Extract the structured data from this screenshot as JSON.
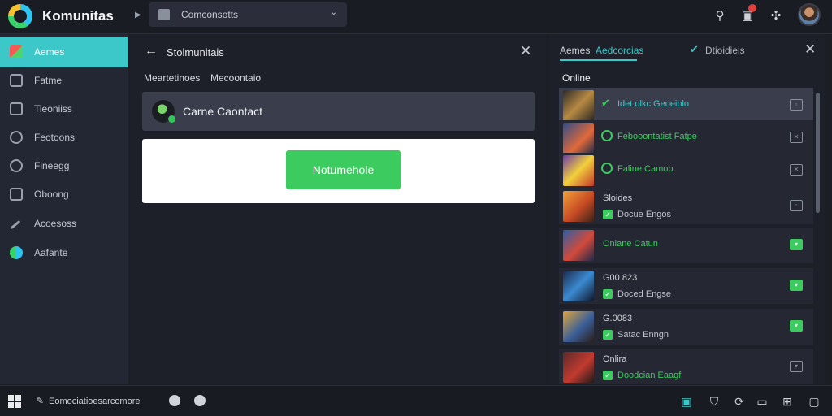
{
  "header": {
    "app_title": "Komunitas",
    "combo_label": "Comconsotts",
    "notification_count": "1"
  },
  "sidebar": {
    "items": [
      {
        "label": "Aemes",
        "active": true
      },
      {
        "label": "Fatme"
      },
      {
        "label": "Tieoniiss"
      },
      {
        "label": "Feotoons"
      },
      {
        "label": "Fineegg"
      },
      {
        "label": "Oboong"
      },
      {
        "label": "Acoesoss"
      },
      {
        "label": "Aafante"
      }
    ]
  },
  "panel": {
    "title": "Stolmunitais",
    "tabs": [
      "Meartetinoes",
      "Mecoontaio"
    ],
    "card_title": "Carne Caontact",
    "button_label": "Notumehole"
  },
  "right": {
    "tab1_a": "Aemes",
    "tab1_b": "Aedcorcias",
    "tab2": "Dtioidieis",
    "section_title": "Online",
    "rows": [
      {
        "label": "Idet olkc Geoeiblo",
        "type": "single"
      },
      {
        "label": "Febooontatist Fatpe",
        "type": "single"
      },
      {
        "label": "Faline Camop",
        "type": "single"
      },
      {
        "sub": "Sloides",
        "label": "Docue Engos",
        "type": "double"
      },
      {
        "label": "Onlane Catun",
        "type": "single"
      },
      {
        "sub": "G00 823",
        "label": "Doced Engse",
        "type": "double"
      },
      {
        "sub": "G.0083",
        "label": "Satac Enngn",
        "type": "double"
      },
      {
        "sub": "Onlira",
        "label": "Doodcian Eaagf",
        "type": "double"
      }
    ]
  },
  "taskbar": {
    "text": "Eomociatioesarcomore"
  }
}
